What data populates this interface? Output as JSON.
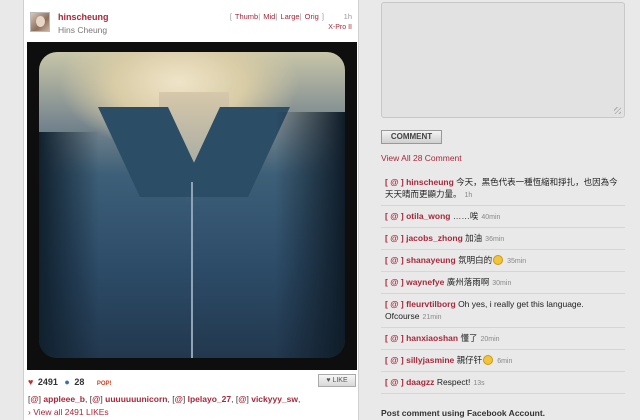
{
  "post": {
    "username": "hinscheung",
    "full_name": "Hins Cheung",
    "sizes": [
      "Thumb",
      "Mid",
      "Large",
      "Orig"
    ],
    "age": "1h",
    "filter": "X-Pro II",
    "like_count": "2491",
    "comment_count": "28",
    "pop_label": "POP!",
    "like_button": "LIKE",
    "likers": [
      "appleee_b",
      "uuuuuuunicorn",
      "lpelayo_27",
      "vickyyy_sw"
    ],
    "view_likes": "View all 2491 LIKEs"
  },
  "comment_box": {
    "button_label": "COMMENT",
    "view_all": "View All 28 Comment",
    "facebook_text": "Post comment using Facebook Account."
  },
  "comments": [
    {
      "user": "hinscheung",
      "text": "今天，黑色代表一種恆縮和掙扎，也因為今天天晴而更顯力量。",
      "time": "1h"
    },
    {
      "user": "otila_wong",
      "text": "……唉",
      "time": "40min"
    },
    {
      "user": "jacobs_zhong",
      "text": "加油",
      "time": "36min"
    },
    {
      "user": "shanayeung",
      "text": "氛明白的",
      "time": "35min",
      "emoji": "smiley-face-icon"
    },
    {
      "user": "waynefye",
      "text": "廣州落雨啊",
      "time": "30min"
    },
    {
      "user": "fleurvtilborg",
      "text": "Oh yes, i really get this language. Ofcourse",
      "time": "21min"
    },
    {
      "user": "hanxiaoshan",
      "text": "懂了",
      "time": "20min"
    },
    {
      "user": "sillyjasmine",
      "text": "親仔钎",
      "time": "6min",
      "emoji": "smiley-face-icon"
    },
    {
      "user": "daagzz",
      "text": "Respect!",
      "time": "13s"
    }
  ],
  "colors": {
    "accent": "#a8283a",
    "heart": "#c03030",
    "comment_bubble": "#3a6fb0"
  }
}
